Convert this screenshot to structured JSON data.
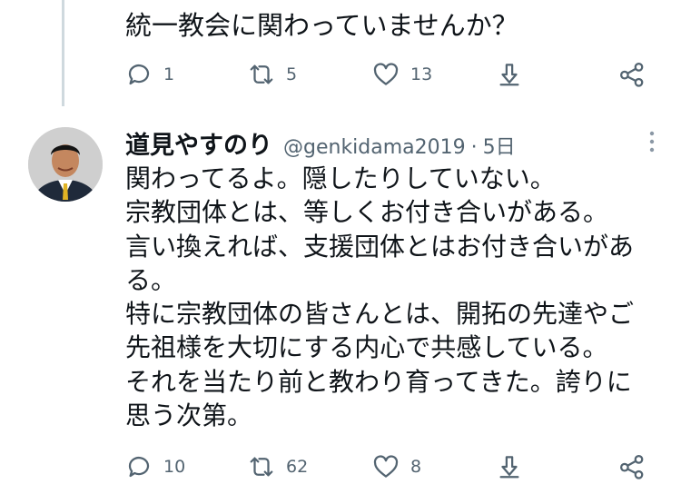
{
  "parent_tweet": {
    "text": "統一教会に関わっていませんか？",
    "actions": {
      "reply_count": "1",
      "retweet_count": "5",
      "like_count": "13"
    }
  },
  "reply_tweet": {
    "author_name": "道見やすのり",
    "handle": "@genkidama2019",
    "separator": "·",
    "timestamp": "5日",
    "body_lines": [
      "関わってるよ。隠したりしていない。",
      "宗教団体とは、等しくお付き合いがある。",
      "言い換えれば、支援団体とはお付き合いがあ",
      "る。",
      "特に宗教団体の皆さんとは、開拓の先達やご",
      "先祖様を大切にする内心で共感している。",
      "それを当たり前と教わり育ってきた。誇りに",
      "思う次第。"
    ],
    "actions": {
      "reply_count": "10",
      "retweet_count": "62",
      "like_count": "8"
    }
  },
  "icons": [
    "reply-icon",
    "retweet-icon",
    "like-icon",
    "bookmark-down-icon",
    "share-icon",
    "more-icon"
  ],
  "colors": {
    "text": "#0f1419",
    "secondary": "#536471",
    "thread_line": "#cfd9de"
  }
}
